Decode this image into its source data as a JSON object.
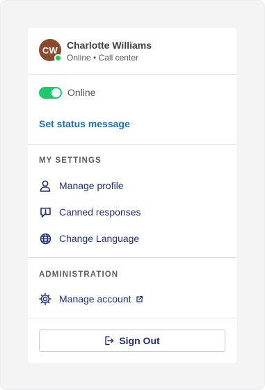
{
  "profile": {
    "initials": "CW",
    "name": "Charlotte Williams",
    "subtitle": "Online • Call center",
    "avatar_color": "#8a4b2e",
    "presence_color": "#22c55e"
  },
  "status": {
    "toggle_on": true,
    "toggle_label": "Online",
    "toggle_color": "#1fc86c",
    "set_message_label": "Set status message"
  },
  "my_settings": {
    "title": "MY SETTINGS",
    "items": [
      {
        "label": "Manage profile",
        "icon": "user-icon"
      },
      {
        "label": "Canned responses",
        "icon": "chat-bubble-icon"
      },
      {
        "label": "Change Language",
        "icon": "globe-icon"
      }
    ]
  },
  "administration": {
    "title": "ADMINISTRATION",
    "items": [
      {
        "label": "Manage account",
        "icon": "gear-icon",
        "external": true
      }
    ]
  },
  "sign_out": {
    "label": "Sign Out",
    "icon": "sign-out-icon"
  },
  "colors": {
    "link": "#1a6fb0",
    "menu_text": "#1f2f78"
  }
}
